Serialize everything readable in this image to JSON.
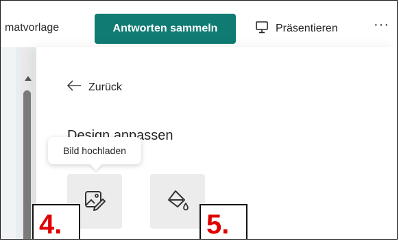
{
  "header": {
    "theme_label": "matvorlage",
    "collect_button": "Antworten sammeln",
    "present_button": "Präsentieren",
    "more_label": "···"
  },
  "panel": {
    "back_label": "Zurück",
    "heading": "Design anpassen",
    "tooltip": "Bild hochladen"
  },
  "annotations": {
    "marker_4": "4.",
    "marker_5": "5."
  },
  "colors": {
    "accent": "#0f7b73",
    "annotation": "#e00000"
  },
  "icons": [
    "present-icon",
    "arrow-left-icon",
    "image-upload-icon",
    "paint-bucket-icon",
    "scroll-up-icon"
  ]
}
